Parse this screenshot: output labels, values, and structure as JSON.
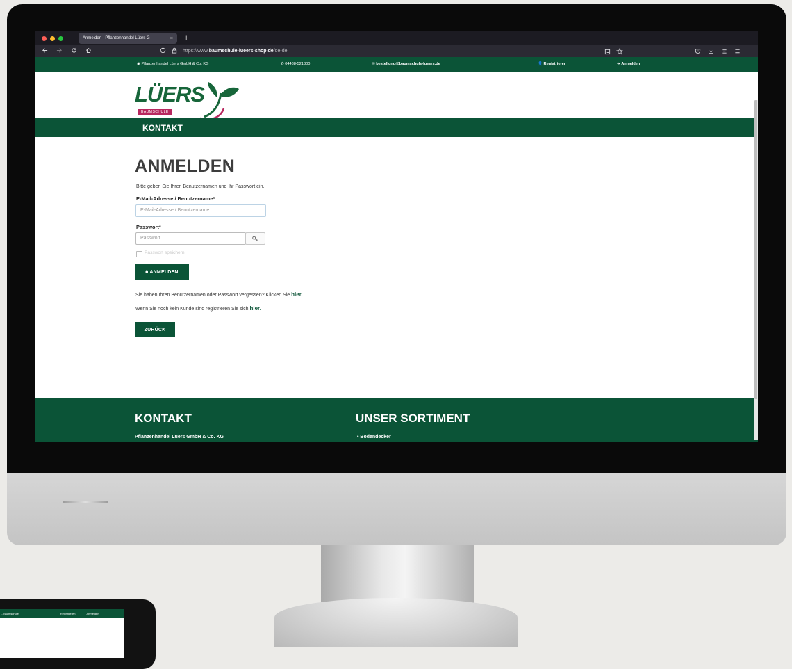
{
  "browser": {
    "tab_title": "Anmelden - Pflanzenhandel Lüers G",
    "tab_close": "×",
    "new_tab": "+",
    "url_prefix": "https://www.",
    "url_domain": "baumschule-lueers-shop.de",
    "url_path": "/de-de",
    "icons": [
      "back-icon",
      "forward-icon",
      "reload-icon",
      "home-icon",
      "shield-icon",
      "lock-icon",
      "reader-view-icon",
      "bookmark-star-icon",
      "pocket-icon",
      "download-icon",
      "extensions-icon",
      "menu-icon"
    ]
  },
  "topbar": {
    "company": "Pflanzenhandel Lüers GmbH & Co. KG",
    "phone": "04488-521300",
    "email": "bestellung@baumschule-lueers.de",
    "register": "Registrieren",
    "login": "Anmelden"
  },
  "logo": {
    "text": "LÜERS",
    "subtitle": "BAUMSCHULE",
    "brand_green": "#17663a",
    "brand_pink": "#b8285f"
  },
  "mainnav": {
    "item": "KONTAKT"
  },
  "login": {
    "heading": "ANMELDEN",
    "intro": "Bitte geben Sie Ihren Benutzernamen und Ihr Passwort ein.",
    "email_label": "E-Mail-Adresse / Benutzername*",
    "email_placeholder": "E-Mail-Adresse / Benutzername",
    "password_label": "Passwort*",
    "password_placeholder": "Passwort",
    "remember_label": "Passwort speichern",
    "submit_label": "ANMELDEN",
    "forgot_text": "Sie haben Ihren Benutzernamen oder Passwort vergessen? Klicken Sie ",
    "forgot_link": "hier.",
    "register_text": "Wenn Sie noch kein Kunde sind registrieren Sie sich ",
    "register_link": "hier.",
    "back_label": "ZURÜCK"
  },
  "footer": {
    "contact_heading": "KONTAKT",
    "contact_company": "Pflanzenhandel Lüers GmbH & Co. KG",
    "assortment_heading": "UNSER SORTIMENT",
    "assortment_first": "Bodendecker"
  },
  "tablet": {
    "left": "...baumschule",
    "register": "Registrieren",
    "login": "Anmelden"
  },
  "colors": {
    "primary_green": "#0b5437",
    "browser_dark": "#1c1b22",
    "browser_toolbar": "#2b2a33"
  }
}
